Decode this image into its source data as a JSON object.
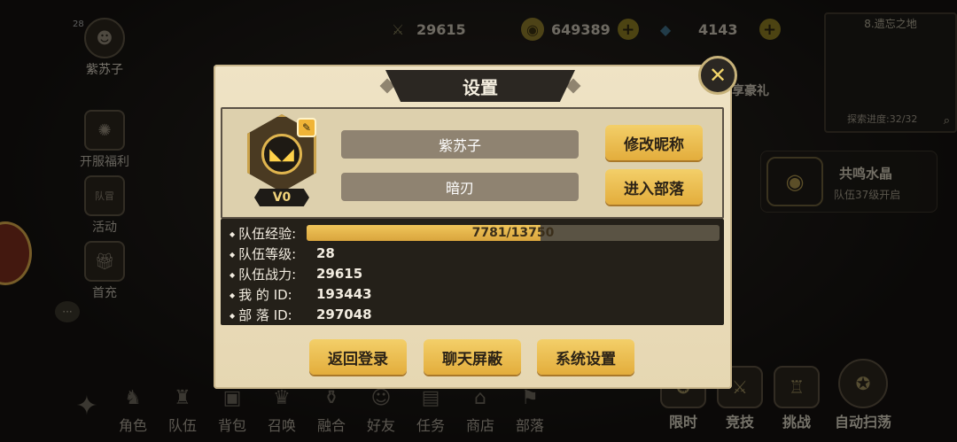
{
  "top_bar": {
    "power": "29615",
    "gold": "649389",
    "gems": "4143"
  },
  "left_menu": {
    "avatar_level": "28",
    "player_name": "紫苏子",
    "items": [
      "开服福利",
      "活动",
      "首充"
    ],
    "activity_badge": "队冒"
  },
  "map": {
    "title": "8.遗忘之地",
    "progress": "探索进度:32/32",
    "gift_label": "享豪礼"
  },
  "crystal": {
    "name": "共鸣水晶",
    "sub": "队伍37级开启"
  },
  "bottom_nav": [
    "角色",
    "队伍",
    "背包",
    "召唤",
    "融合",
    "好友",
    "任务",
    "商店",
    "部落"
  ],
  "right_nav": [
    "限时",
    "竞技",
    "挑战",
    "自动扫荡"
  ],
  "dialog": {
    "title": "设置",
    "vip": "V0",
    "nickname": "紫苏子",
    "tribe_name": "暗刃",
    "rename_button": "修改昵称",
    "enter_tribe_button": "进入部落",
    "stats": {
      "exp_label": "队伍经验:",
      "exp_text": "7781/13750",
      "exp_fraction": 0.566,
      "level_label": "队伍等级:",
      "level": "28",
      "power_label": "队伍战力:",
      "power": "29615",
      "id_label": "我 的 ID:",
      "id": "193443",
      "tribe_id_label": "部 落 ID:",
      "tribe_id": "297048"
    },
    "buttons": {
      "logout": "返回登录",
      "chat_block": "聊天屏蔽",
      "system_settings": "系统设置"
    }
  },
  "colors": {
    "dialog_bg": "#efe3c5",
    "gold_button": "#e8b84a",
    "dark_panel": "#242019"
  }
}
